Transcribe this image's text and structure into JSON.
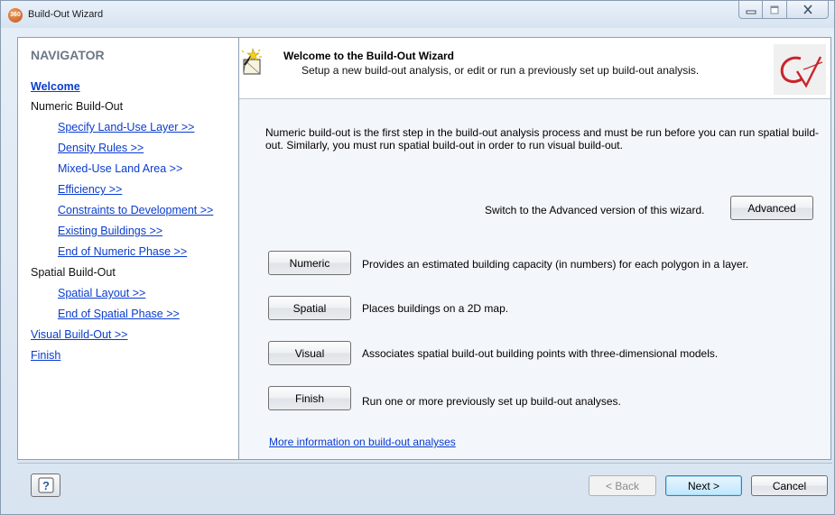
{
  "window": {
    "title": "Build-Out Wizard",
    "app_icon_text": "360",
    "controls": {
      "minimize": "minimize",
      "maximize": "maximize",
      "close": "close"
    }
  },
  "navigator": {
    "title": "NAVIGATOR",
    "items": [
      {
        "label": "Welcome",
        "kind": "link",
        "active": true
      },
      {
        "label": "Numeric Build-Out",
        "kind": "static"
      },
      {
        "label": "Specify Land-Use Layer >>",
        "kind": "link"
      },
      {
        "label": "Density Rules >>",
        "kind": "link"
      },
      {
        "label": "Mixed-Use Land Area >>",
        "kind": "link"
      },
      {
        "label": "Efficiency >>",
        "kind": "link"
      },
      {
        "label": "Constraints to Development >>",
        "kind": "link"
      },
      {
        "label": "Existing Buildings >>",
        "kind": "link"
      },
      {
        "label": "End of Numeric Phase >>",
        "kind": "link"
      },
      {
        "label": "Spatial Build-Out",
        "kind": "static"
      },
      {
        "label": "Spatial Layout >>",
        "kind": "link"
      },
      {
        "label": "End of Spatial Phase >>",
        "kind": "link"
      },
      {
        "label": "Visual Build-Out >>",
        "kind": "link"
      },
      {
        "label": "Finish",
        "kind": "link"
      }
    ]
  },
  "header": {
    "title": "Welcome to the Build-Out Wizard",
    "subtitle": "Setup a new build-out analysis, or edit or run a previously set up build-out analysis.",
    "logo_text": "CV"
  },
  "content": {
    "description": "Numeric build-out is the first step in the build-out analysis process and must be run before you can run spatial build-out. Similarly, you must run spatial build-out in order to run visual build-out.",
    "advanced_prompt": "Switch to the Advanced version of this wizard.",
    "advanced_button": "Advanced",
    "actions": [
      {
        "button": "Numeric",
        "description": "Provides an estimated building capacity (in numbers) for each polygon in a layer."
      },
      {
        "button": "Spatial",
        "description": "Places buildings on a 2D map."
      },
      {
        "button": "Visual",
        "description": "Associates spatial build-out building points with three-dimensional models."
      },
      {
        "button": "Finish",
        "description": "Run one or more previously set up build-out analyses."
      }
    ],
    "more_info_link": "More information on build-out analyses"
  },
  "footer": {
    "help_icon": "?",
    "back": "< Back",
    "next": "Next >",
    "cancel": "Cancel"
  }
}
